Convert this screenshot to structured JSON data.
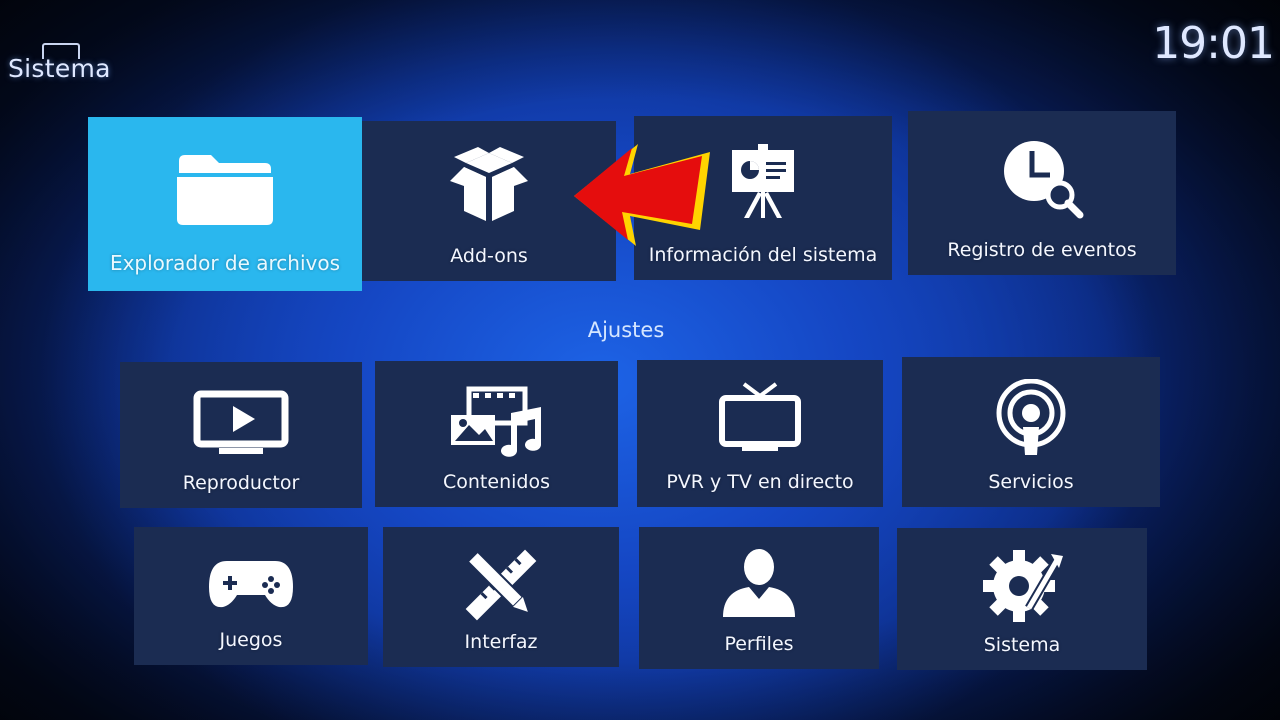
{
  "header": {
    "title": "Sistema",
    "clock": "19:01"
  },
  "top_row": [
    {
      "label": "Explorador de archivos",
      "icon": "folder-icon",
      "focused": true
    },
    {
      "label": "Add-ons",
      "icon": "box-icon"
    },
    {
      "label": "Información del sistema",
      "icon": "presentation-icon"
    },
    {
      "label": "Registro de eventos",
      "icon": "clock-search-icon"
    }
  ],
  "settings_section": {
    "title": "Ajustes",
    "items": [
      {
        "label": "Reproductor",
        "icon": "play-screen-icon"
      },
      {
        "label": "Contenidos",
        "icon": "media-library-icon"
      },
      {
        "label": "PVR y TV en directo",
        "icon": "tv-icon"
      },
      {
        "label": "Servicios",
        "icon": "broadcast-icon"
      },
      {
        "label": "Juegos",
        "icon": "gamepad-icon"
      },
      {
        "label": "Interfaz",
        "icon": "pencil-ruler-icon"
      },
      {
        "label": "Perfiles",
        "icon": "user-icon"
      },
      {
        "label": "Sistema",
        "icon": "gear-tools-icon"
      }
    ]
  },
  "colors": {
    "focused_tile": "#2ab7ee",
    "tile": "#1b2c52",
    "background": "#1547c4",
    "annotation_arrow": "#e50d0d",
    "annotation_arrow_outline": "#ffd400"
  }
}
